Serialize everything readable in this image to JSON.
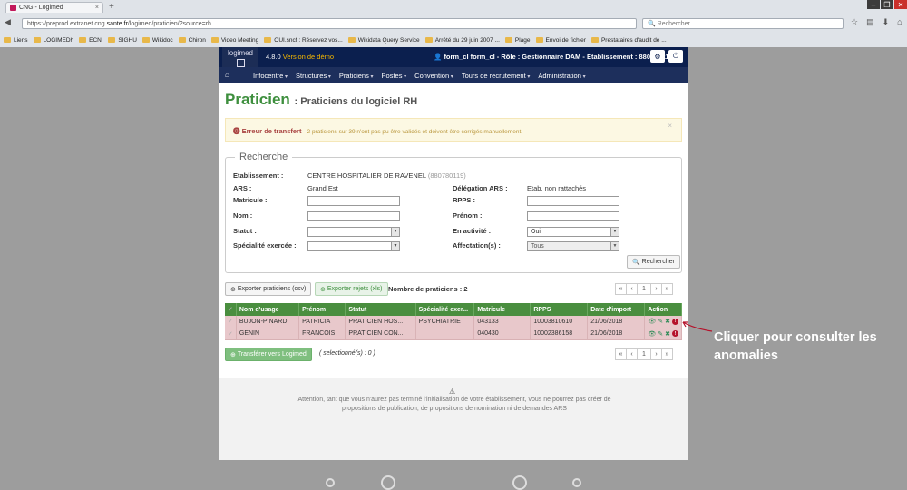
{
  "browser": {
    "tab_title": "CNG - Logimed",
    "tab_close": "×",
    "new_tab": "+",
    "url_prefix": "https://preprod.extranet.cng.",
    "url_domain": "sante.fr",
    "url_path": "/logimed/praticien/?source=rh",
    "search_placeholder": "Rechercher",
    "bookmarks": [
      "Liens",
      "LOGIMEDh",
      "ECNi",
      "SIGHU",
      "Wikidoc",
      "Chiron",
      "Video Meeting",
      "OUI.sncf : Réservez vos...",
      "Wikidata Query Service",
      "Arrêté du 29 juin 2007 ...",
      "Plage",
      "Envoi de fichier",
      "Prestataires d'audit de ..."
    ]
  },
  "app": {
    "logo_text": "logimed",
    "version_num": "4.8.0",
    "version_label": "Version de démo",
    "user_info": "form_cl form_cl - Rôle : Gestionnaire DAM - Etablissement : 880780119",
    "menu": [
      "Infocentre",
      "Structures",
      "Praticiens",
      "Postes",
      "Convention",
      "Tours de recrutement",
      "Administration"
    ]
  },
  "page": {
    "title": "Praticien",
    "subtitle": ": Praticiens du logiciel RH"
  },
  "alert": {
    "title": "Erreur de transfert",
    "text": "- 2 praticiens sur 39 n'ont pas pu être validés et doivent être corrigés manuellement.",
    "close": "×"
  },
  "search": {
    "legend": "Recherche",
    "etablissement_label": "Etablissement :",
    "etablissement_value": "CENTRE HOSPITALIER DE RAVENEL",
    "etablissement_code": "(880780119)",
    "ars_label": "ARS :",
    "ars_value": "Grand Est",
    "delegation_label": "Délégation ARS :",
    "delegation_value": "Etab. non rattachés",
    "matricule_label": "Matricule :",
    "rpps_label": "RPPS :",
    "nom_label": "Nom :",
    "prenom_label": "Prénom :",
    "statut_label": "Statut :",
    "activite_label": "En activité :",
    "activite_value": "Oui",
    "specialite_label": "Spécialité exercée :",
    "affectation_label": "Affectation(s) :",
    "affectation_value": "Tous",
    "submit": "Rechercher"
  },
  "toolbar": {
    "export_csv": "Exporter praticiens (csv)",
    "export_xls": "Exporter rejets (xls)",
    "count": "Nombre de praticiens : 2",
    "pager": [
      "«",
      "‹",
      "1",
      "›",
      "»"
    ]
  },
  "table": {
    "headers": [
      "Nom d'usage",
      "Prénom",
      "Statut",
      "Spécialité exer...",
      "Matricule",
      "RPPS",
      "Date d'import",
      "Action"
    ],
    "rows": [
      {
        "nom": "BUJON-PINARD",
        "prenom": "PATRICIA",
        "statut": "PRATICIEN HOS...",
        "specialite": "PSYCHIATRIE",
        "matricule": "043133",
        "rpps": "10003810610",
        "date": "21/06/2018"
      },
      {
        "nom": "GENIN",
        "prenom": "FRANCOIS",
        "statut": "PRATICIEN CON...",
        "specialite": "",
        "matricule": "040430",
        "rpps": "10002386158",
        "date": "21/06/2018"
      }
    ]
  },
  "bottom": {
    "transfer": "Transférer vers Logimed",
    "selected": "( selectionné(s) : 0 )"
  },
  "footer": {
    "text": "Attention, tant que vous n'aurez pas terminé l'initialisation de votre établissement, vous ne pourrez pas créer de propositions de publication, de propositions de nomination ni de demandes ARS"
  },
  "annotation": {
    "text": "Cliquer pour consulter les anomalies"
  }
}
